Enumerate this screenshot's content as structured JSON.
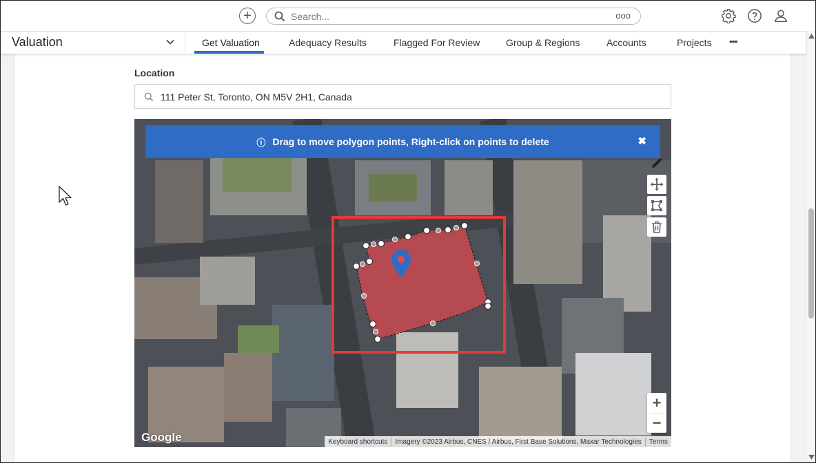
{
  "topbar": {
    "search_placeholder": "Search...",
    "more_label": "ooo"
  },
  "nav": {
    "module_title": "Valuation",
    "tabs": [
      {
        "label": "Get Valuation",
        "active": true
      },
      {
        "label": "Adequacy Results"
      },
      {
        "label": "Flagged For Review"
      },
      {
        "label": "Group & Regions"
      },
      {
        "label": "Accounts"
      },
      {
        "label": "Projects"
      }
    ],
    "more_label": "•••"
  },
  "location": {
    "label": "Location",
    "value": "111 Peter St, Toronto, ON M5V 2H1, Canada"
  },
  "map": {
    "banner_text": "Drag to move polygon points, Right-click on points to delete",
    "zoom_in": "+",
    "zoom_out": "−",
    "google_label": "Google",
    "attribution": {
      "shortcuts": "Keyboard shortcuts",
      "imagery": "Imagery ©2023 Airbus, CNES / Airbus, First Base Solutions, Maxar Technologies",
      "terms": "Terms"
    },
    "polygon_color": "#e8474c",
    "highlight_color": "#e53935",
    "marker_color": "#2f6cc6"
  },
  "accent_color": "#2f6cc6"
}
